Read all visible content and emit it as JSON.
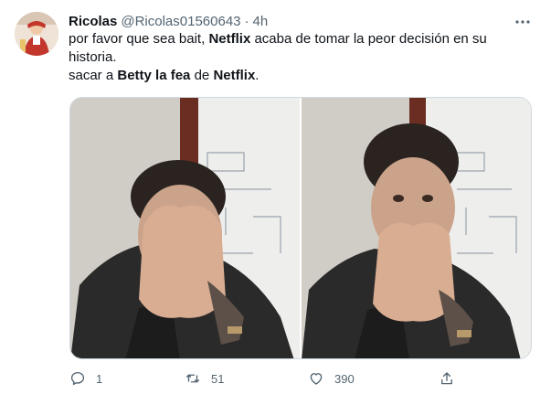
{
  "tweet": {
    "display_name": "Ricolas",
    "handle": "@Ricolas01560643",
    "separator": "·",
    "time": "4h",
    "text": {
      "line1_a": "por favor que sea bait, ",
      "line1_b": "Netflix",
      "line1_c": " acaba de tomar la peor decisión en su historia.",
      "line2_a": "sacar a ",
      "line2_b": "Betty la fea",
      "line2_c": " de ",
      "line2_d": "Netflix",
      "line2_e": "."
    },
    "actions": {
      "replies": "1",
      "retweets": "51",
      "likes": "390"
    }
  },
  "icons": [
    "avatar",
    "more-icon",
    "reply-icon",
    "retweet-icon",
    "like-icon",
    "share-icon"
  ],
  "colors": {
    "text_primary": "#0f1419",
    "text_secondary": "#536471",
    "border": "#cfd9de"
  }
}
